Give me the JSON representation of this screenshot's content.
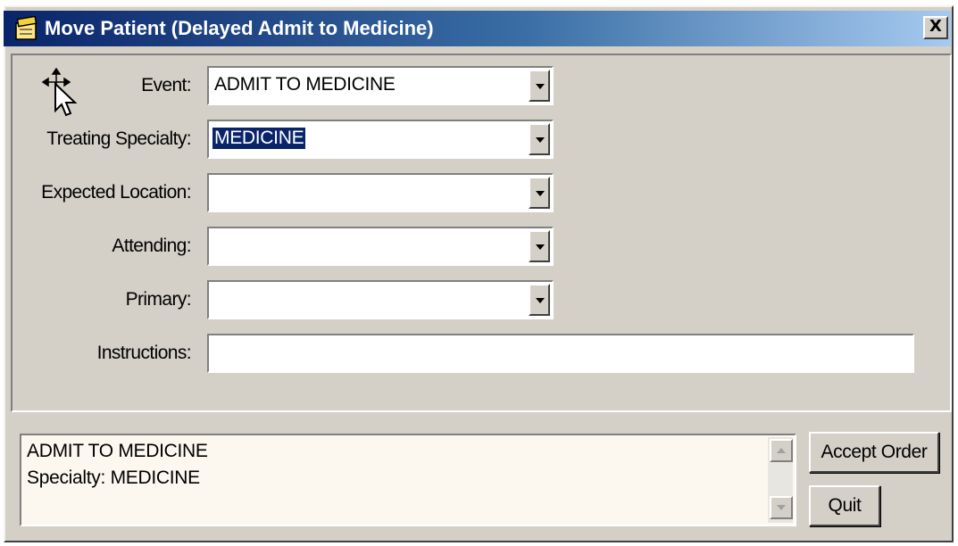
{
  "window": {
    "title": "Move Patient (Delayed Admit to Medicine)",
    "close_label": "X"
  },
  "form": {
    "event": {
      "label": "Event:",
      "value": "ADMIT TO MEDICINE"
    },
    "treating_specialty": {
      "label": "Treating Specialty:",
      "value": "MEDICINE"
    },
    "expected_location": {
      "label": "Expected Location:",
      "value": ""
    },
    "attending": {
      "label": "Attending:",
      "value": ""
    },
    "primary": {
      "label": "Primary:",
      "value": ""
    },
    "instructions": {
      "label": "Instructions:",
      "value": ""
    }
  },
  "summary": {
    "lines": [
      "ADMIT TO MEDICINE",
      "Specialty:  MEDICINE"
    ]
  },
  "buttons": {
    "accept": "Accept Order",
    "quit": "Quit"
  },
  "colors": {
    "title_bar_start": "#0a246a",
    "title_bar_end": "#a6caf0",
    "window_face": "#d4d0c8",
    "selection": "#0a246a"
  },
  "icons": {
    "title": "notepad-icon",
    "cursor": "move-cursor-icon",
    "combo": "chevron-down-icon",
    "scroll_up": "scroll-up-icon",
    "scroll_down": "scroll-down-icon"
  }
}
